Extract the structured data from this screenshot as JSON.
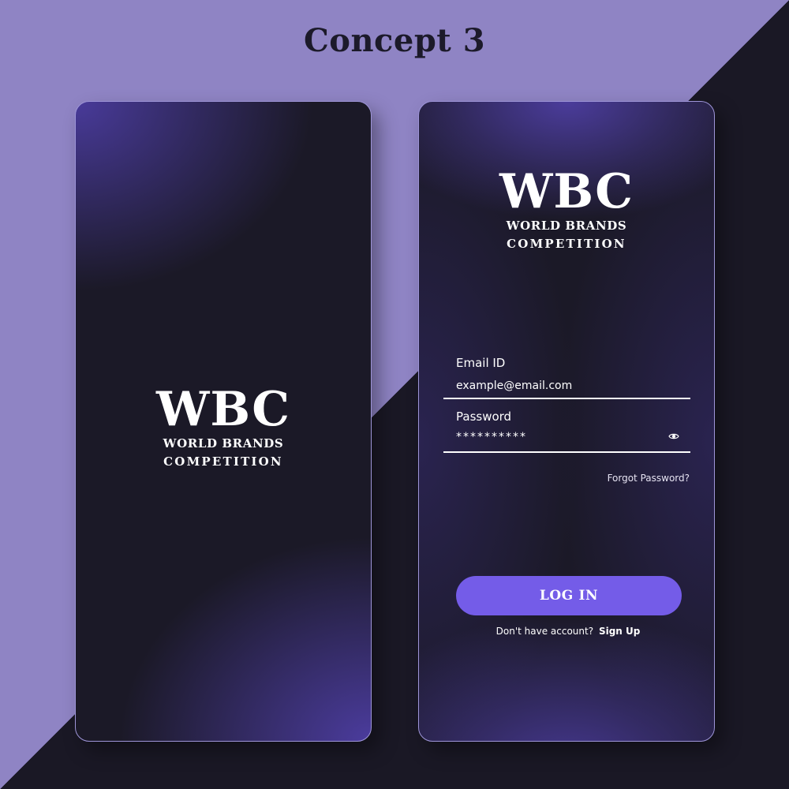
{
  "page": {
    "title": "Concept 3"
  },
  "splash_screen": {
    "logo": {
      "mark": "WBC",
      "line1": "WORLD BRANDS",
      "line2": "COMPETITION"
    }
  },
  "login_screen": {
    "logo": {
      "mark": "WBC",
      "line1": "WORLD BRANDS",
      "line2": "COMPETITION"
    },
    "email_field": {
      "label": "Email ID",
      "value": "example@email.com"
    },
    "password_field": {
      "label": "Password",
      "value": "**********",
      "toggle_icon": "eye-icon"
    },
    "forgot_password": "Forgot Password?",
    "login_button": "LOG IN",
    "signup_prompt": "Don't have account?",
    "signup_link": "Sign Up"
  },
  "colors": {
    "background_light": "#8f84c4",
    "background_dark": "#1a1825",
    "screen_bg": "#1b1927",
    "accent_purple": "#745ce8",
    "glow_purple": "#4e3ea5"
  }
}
